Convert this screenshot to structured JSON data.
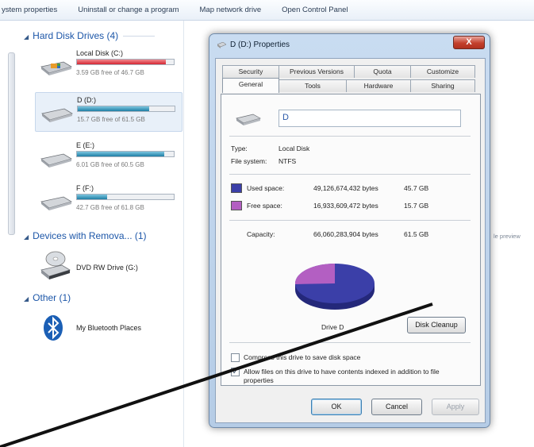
{
  "toolbar": {
    "items": [
      "ystem properties",
      "Uninstall or change a program",
      "Map network drive",
      "Open Control Panel"
    ]
  },
  "left_pane": {
    "hard_disk_header": "Hard Disk Drives (4)",
    "drives": [
      {
        "name": "Local Disk (C:)",
        "free": "3.59 GB free of 46.7 GB",
        "used_fraction": 0.92,
        "bar_color": "#e0333c"
      },
      {
        "name": "D (D:)",
        "free": "15.7 GB free of 61.5 GB",
        "used_fraction": 0.74,
        "bar_color": "#2a8fb3"
      },
      {
        "name": "E (E:)",
        "free": "6.01 GB free of 60.5 GB",
        "used_fraction": 0.9,
        "bar_color": "#2a8fb3"
      },
      {
        "name": "F (F:)",
        "free": "42.7 GB free of 61.8 GB",
        "used_fraction": 0.31,
        "bar_color": "#2a8fb3"
      }
    ],
    "removable_header": "Devices with Remova... (1)",
    "dvd_label": "DVD RW Drive (G:)",
    "other_header": "Other (1)",
    "bluetooth_label": "My Bluetooth Places"
  },
  "dialog": {
    "title": "D (D:) Properties",
    "close_label": "X",
    "tabs_back": [
      "Security",
      "Previous Versions",
      "Quota",
      "Customize"
    ],
    "tabs_front": [
      "General",
      "Tools",
      "Hardware",
      "Sharing"
    ],
    "active_tab": "General",
    "volume_name": "D",
    "type_label": "Type:",
    "type_value": "Local Disk",
    "fs_label": "File system:",
    "fs_value": "NTFS",
    "used_label": "Used space:",
    "used_bytes": "49,126,674,432 bytes",
    "used_gb": "45.7 GB",
    "free_label": "Free space:",
    "free_bytes": "16,933,609,472 bytes",
    "free_gb": "15.7 GB",
    "capacity_label": "Capacity:",
    "capacity_bytes": "66,060,283,904 bytes",
    "capacity_gb": "61.5 GB",
    "used_color": "#3b3fa8",
    "free_color": "#b35fc2",
    "used_fraction": 0.744,
    "drive_caption": "Drive D",
    "disk_cleanup_label": "Disk Cleanup",
    "compress_label": "Compress this drive to save disk space",
    "index_label": "Allow files on this drive to have contents indexed in addition to file properties",
    "compress_checked": false,
    "index_checked": true,
    "ok_label": "OK",
    "cancel_label": "Cancel",
    "apply_label": "Apply"
  },
  "side_text": "le preview"
}
